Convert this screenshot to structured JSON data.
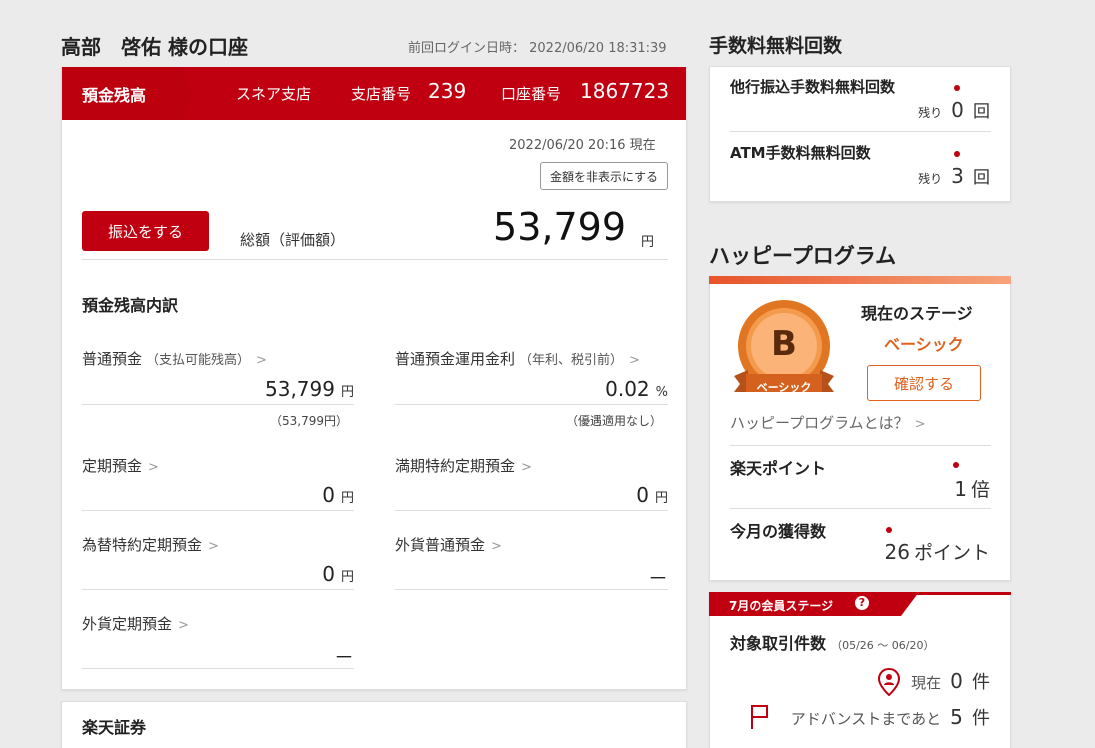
{
  "header": {
    "account_title": "高部　啓佑 様の口座",
    "last_login": "前回ログイン日時： 2022/06/20 18:31:39"
  },
  "balance": {
    "tab_label": "預金残高",
    "branch_name": "スネア支店",
    "branch_no_label": "支店番号",
    "branch_no": "239",
    "account_no_label": "口座番号",
    "account_no": "1867723",
    "as_of": "2022/06/20 20:16 現在",
    "hide_button": "金額を非表示にする",
    "transfer_button": "振込をする",
    "total_label": "総額（評価額）",
    "total_value": "53,799",
    "yen": "円"
  },
  "breakdown": {
    "title": "預金残高内訳",
    "items": [
      {
        "label": "普通預金",
        "note": "（支払可能残高）",
        "value": "53,799",
        "unit": "円",
        "sub": "（53,799円）"
      },
      {
        "label": "普通預金運用金利",
        "note": "（年利、税引前）",
        "value": "0.02",
        "unit": "%",
        "sub": "（優遇適用なし）"
      },
      {
        "label": "定期預金",
        "note": "",
        "value": "0",
        "unit": "円",
        "sub": ""
      },
      {
        "label": "満期特約定期預金",
        "note": "",
        "value": "0",
        "unit": "円",
        "sub": ""
      },
      {
        "label": "為替特約定期預金",
        "note": "",
        "value": "0",
        "unit": "円",
        "sub": ""
      },
      {
        "label": "外貨普通預金",
        "note": "",
        "value": "－",
        "unit": "",
        "sub": ""
      },
      {
        "label": "外貨定期預金",
        "note": "",
        "value": "－",
        "unit": "",
        "sub": ""
      }
    ]
  },
  "securities": {
    "title": "楽天証券"
  },
  "fees": {
    "title": "手数料無料回数",
    "items": [
      {
        "label": "他行振込手数料無料回数",
        "remain_label": "残り",
        "count": "0",
        "unit": "回"
      },
      {
        "label": "ATM手数料無料回数",
        "remain_label": "残り",
        "count": "3",
        "unit": "回"
      }
    ]
  },
  "happy": {
    "title": "ハッピープログラム",
    "stage_heading": "現在のステージ",
    "stage_name": "ベーシック",
    "badge_letter": "B",
    "badge_ribbon": "ベーシック",
    "confirm_button": "確認する",
    "about_link": "ハッピープログラムとは？",
    "points_label": "楽天ポイント",
    "points_multiplier": "1",
    "points_multiplier_unit": "倍",
    "monthly_label": "今月の獲得数",
    "monthly_points": "26",
    "monthly_points_unit": "ポイント"
  },
  "member_stage": {
    "banner": "7月の会員ステージ",
    "help_icon": "?",
    "count_label": "対象取引件数",
    "period": "（05/26 ～ 06/20）",
    "current_label": "現在",
    "current_count": "0",
    "count_unit": "件",
    "advance_label": "アドバンストまであと",
    "advance_count": "5"
  },
  "colors": {
    "brand_red": "#c00010",
    "orange": "#e0621e",
    "background": "#ebebeb"
  }
}
